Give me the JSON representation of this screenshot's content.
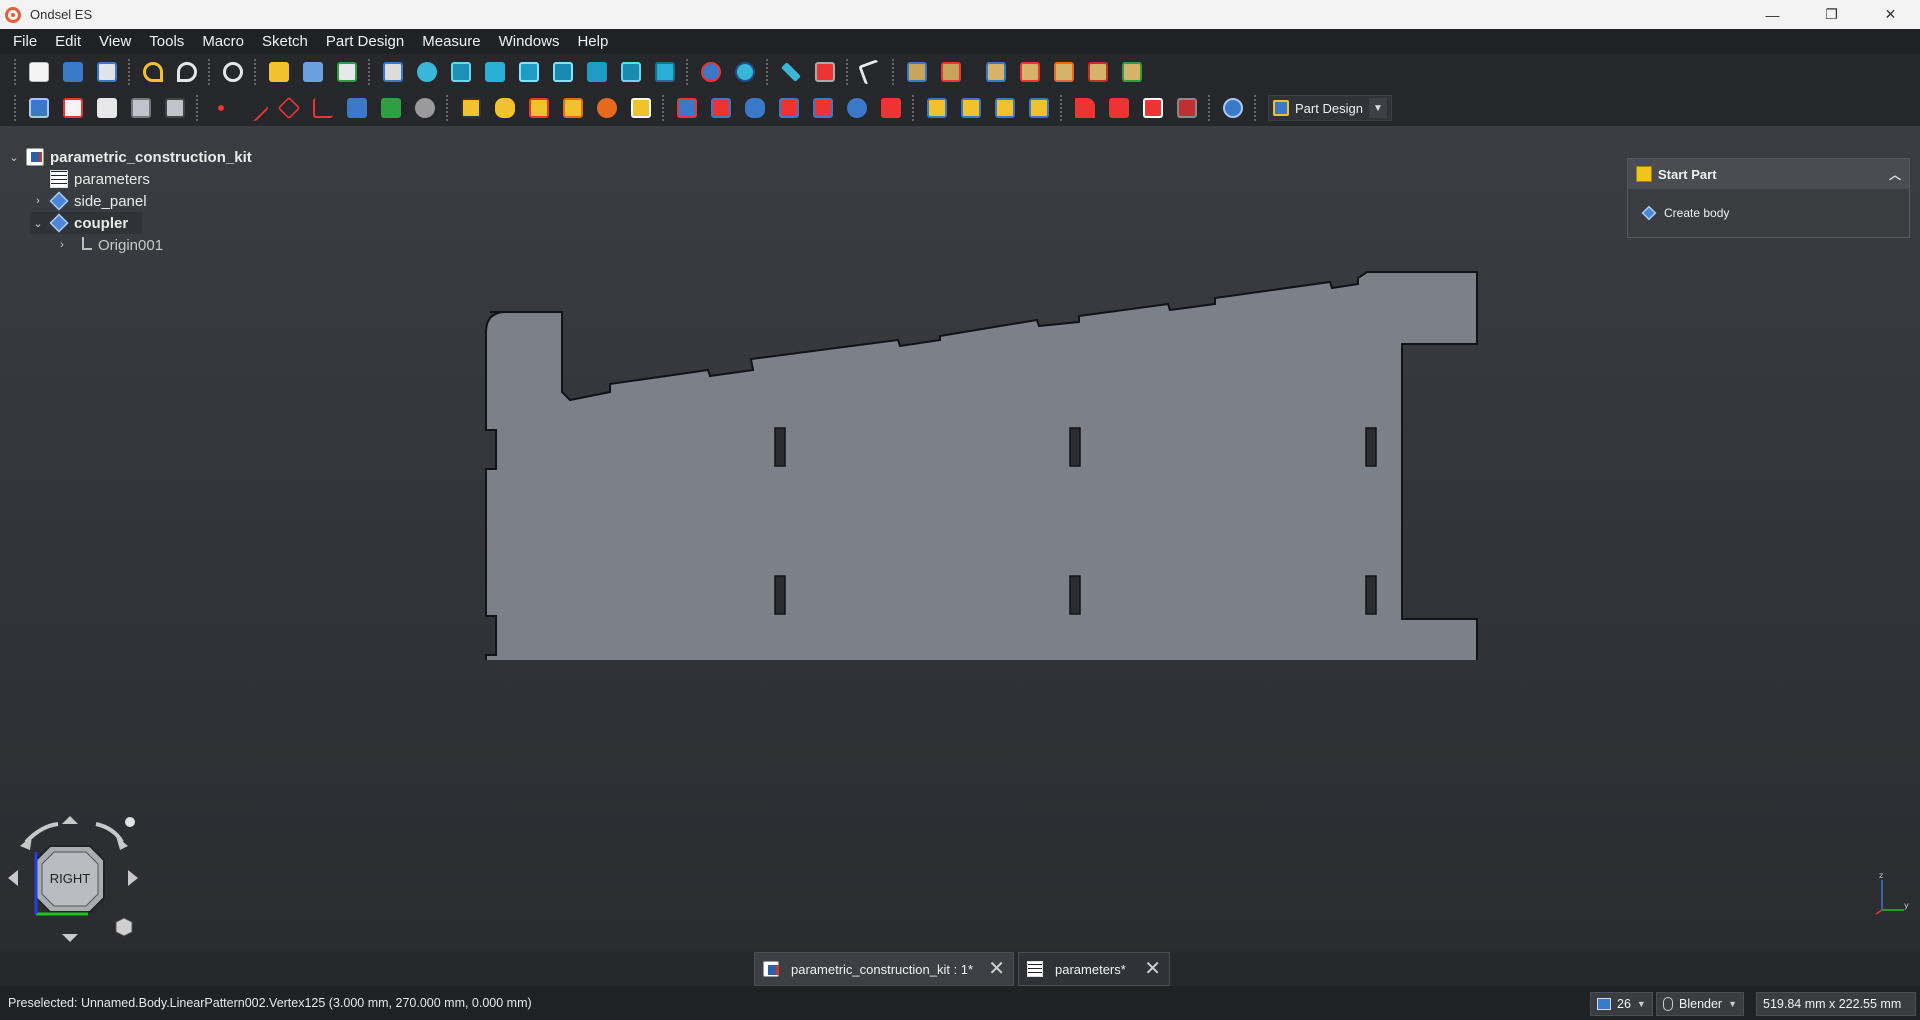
{
  "window": {
    "title": "Ondsel ES",
    "minimize": "—",
    "maximize": "❐",
    "close": "✕"
  },
  "menu": [
    "File",
    "Edit",
    "View",
    "Tools",
    "Macro",
    "Sketch",
    "Part Design",
    "Measure",
    "Windows",
    "Help"
  ],
  "workbench": {
    "label": "Part Design"
  },
  "tree": {
    "root": "parametric_construction_kit",
    "items": [
      "parameters",
      "side_panel",
      "coupler",
      "Origin001"
    ]
  },
  "task_panel": {
    "header": "Start Part",
    "action": "Create body"
  },
  "navcube": {
    "face": "RIGHT"
  },
  "axis": {
    "z": "z",
    "y": "y"
  },
  "doc_tabs": [
    {
      "label": "parametric_construction_kit : 1*"
    },
    {
      "label": "parameters*"
    }
  ],
  "status": {
    "text": "Preselected: Unnamed.Body.LinearPattern002.Vertex125 (3.000 mm, 270.000 mm, 0.000 mm)",
    "count": "26",
    "nav_style": "Blender",
    "dimensions": "519.84 mm x 222.55 mm"
  },
  "colors": {
    "part_fill": "#7c8089",
    "part_edge": "#111318",
    "accent_blue": "#3a78c8",
    "accent_yellow": "#f2c12e"
  }
}
